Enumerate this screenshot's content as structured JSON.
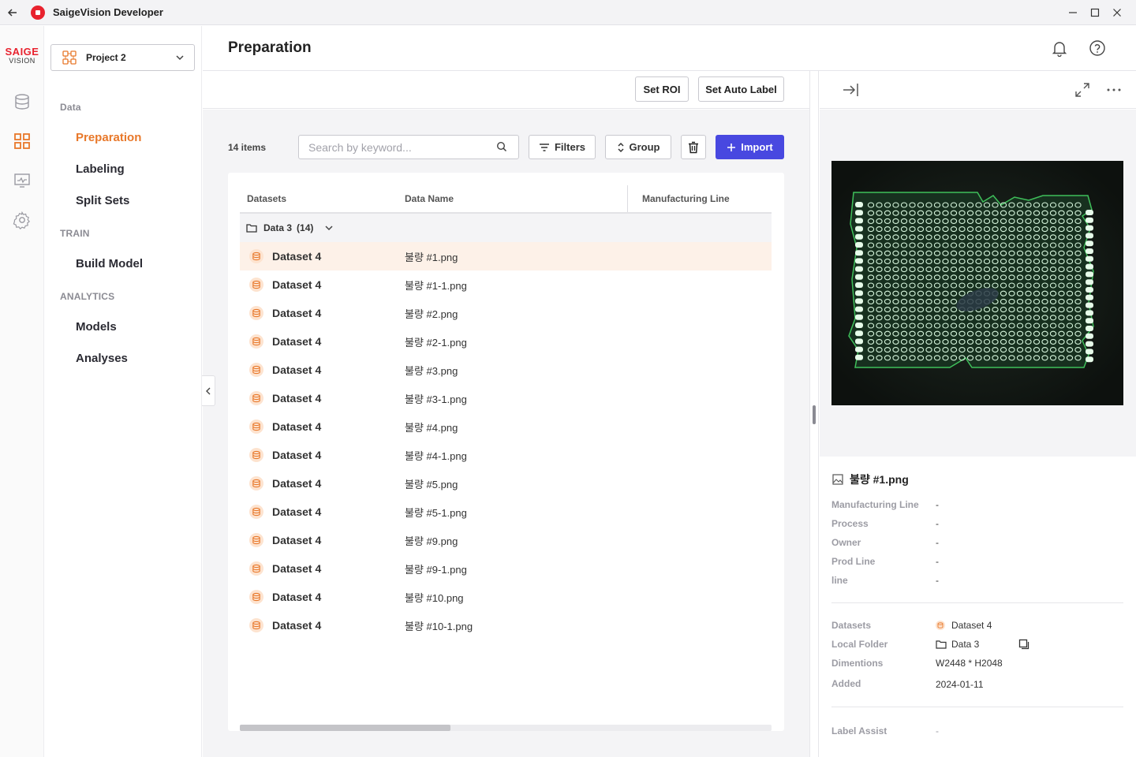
{
  "window": {
    "title": "SaigeVision Developer"
  },
  "brand": {
    "top": "SAIGE",
    "bottom": "VISION",
    "color": "#e8222e"
  },
  "accent": {
    "primary": "#4848e0",
    "active_nav": "#e8782a"
  },
  "project": {
    "name": "Project 2"
  },
  "nav": {
    "data_section": "Data",
    "preparation": "Preparation",
    "labeling": "Labeling",
    "split_sets": "Split Sets",
    "train_section": "TRAIN",
    "build_model": "Build Model",
    "analytics_section": "ANALYTICS",
    "models": "Models",
    "analyses": "Analyses"
  },
  "header": {
    "title": "Preparation"
  },
  "toolbar": {
    "set_roi": "Set ROI",
    "set_auto_label": "Set Auto Label"
  },
  "list": {
    "count_label": "14 items",
    "search_placeholder": "Search by keyword...",
    "filters": "Filters",
    "group": "Group",
    "import": "Import",
    "columns": {
      "datasets": "Datasets",
      "data_name": "Data Name",
      "manufacturing_line": "Manufacturing Line"
    },
    "group_row": {
      "name": "Data 3",
      "count": "(14)"
    },
    "rows": [
      {
        "dataset": "Dataset 4",
        "name": "불량 #1.png"
      },
      {
        "dataset": "Dataset 4",
        "name": "불량 #1-1.png"
      },
      {
        "dataset": "Dataset 4",
        "name": "불량 #2.png"
      },
      {
        "dataset": "Dataset 4",
        "name": "불량 #2-1.png"
      },
      {
        "dataset": "Dataset 4",
        "name": "불량 #3.png"
      },
      {
        "dataset": "Dataset 4",
        "name": "불량 #3-1.png"
      },
      {
        "dataset": "Dataset 4",
        "name": "불량 #4.png"
      },
      {
        "dataset": "Dataset 4",
        "name": "불량 #4-1.png"
      },
      {
        "dataset": "Dataset 4",
        "name": "불량 #5.png"
      },
      {
        "dataset": "Dataset 4",
        "name": "불량 #5-1.png"
      },
      {
        "dataset": "Dataset 4",
        "name": "불량 #9.png"
      },
      {
        "dataset": "Dataset 4",
        "name": "불량 #9-1.png"
      },
      {
        "dataset": "Dataset 4",
        "name": "불량 #10.png"
      },
      {
        "dataset": "Dataset 4",
        "name": "불량 #10-1.png"
      }
    ]
  },
  "detail": {
    "file_name": "불량 #1.png",
    "fields": {
      "manufacturing_line": {
        "label": "Manufacturing Line",
        "value": "-"
      },
      "process": {
        "label": "Process",
        "value": "-"
      },
      "owner": {
        "label": "Owner",
        "value": "-"
      },
      "prod_line": {
        "label": "Prod Line",
        "value": "-"
      },
      "line": {
        "label": "line",
        "value": "-"
      }
    },
    "info": {
      "datasets": {
        "label": "Datasets",
        "value": "Dataset 4"
      },
      "local_folder": {
        "label": "Local Folder",
        "value": "Data 3"
      },
      "dimentions": {
        "label": "Dimentions",
        "value": "W2448 * H2048"
      },
      "added": {
        "label": "Added",
        "value": "2024-01-11"
      }
    },
    "label_assist": {
      "label": "Label Assist",
      "value": "-"
    }
  }
}
